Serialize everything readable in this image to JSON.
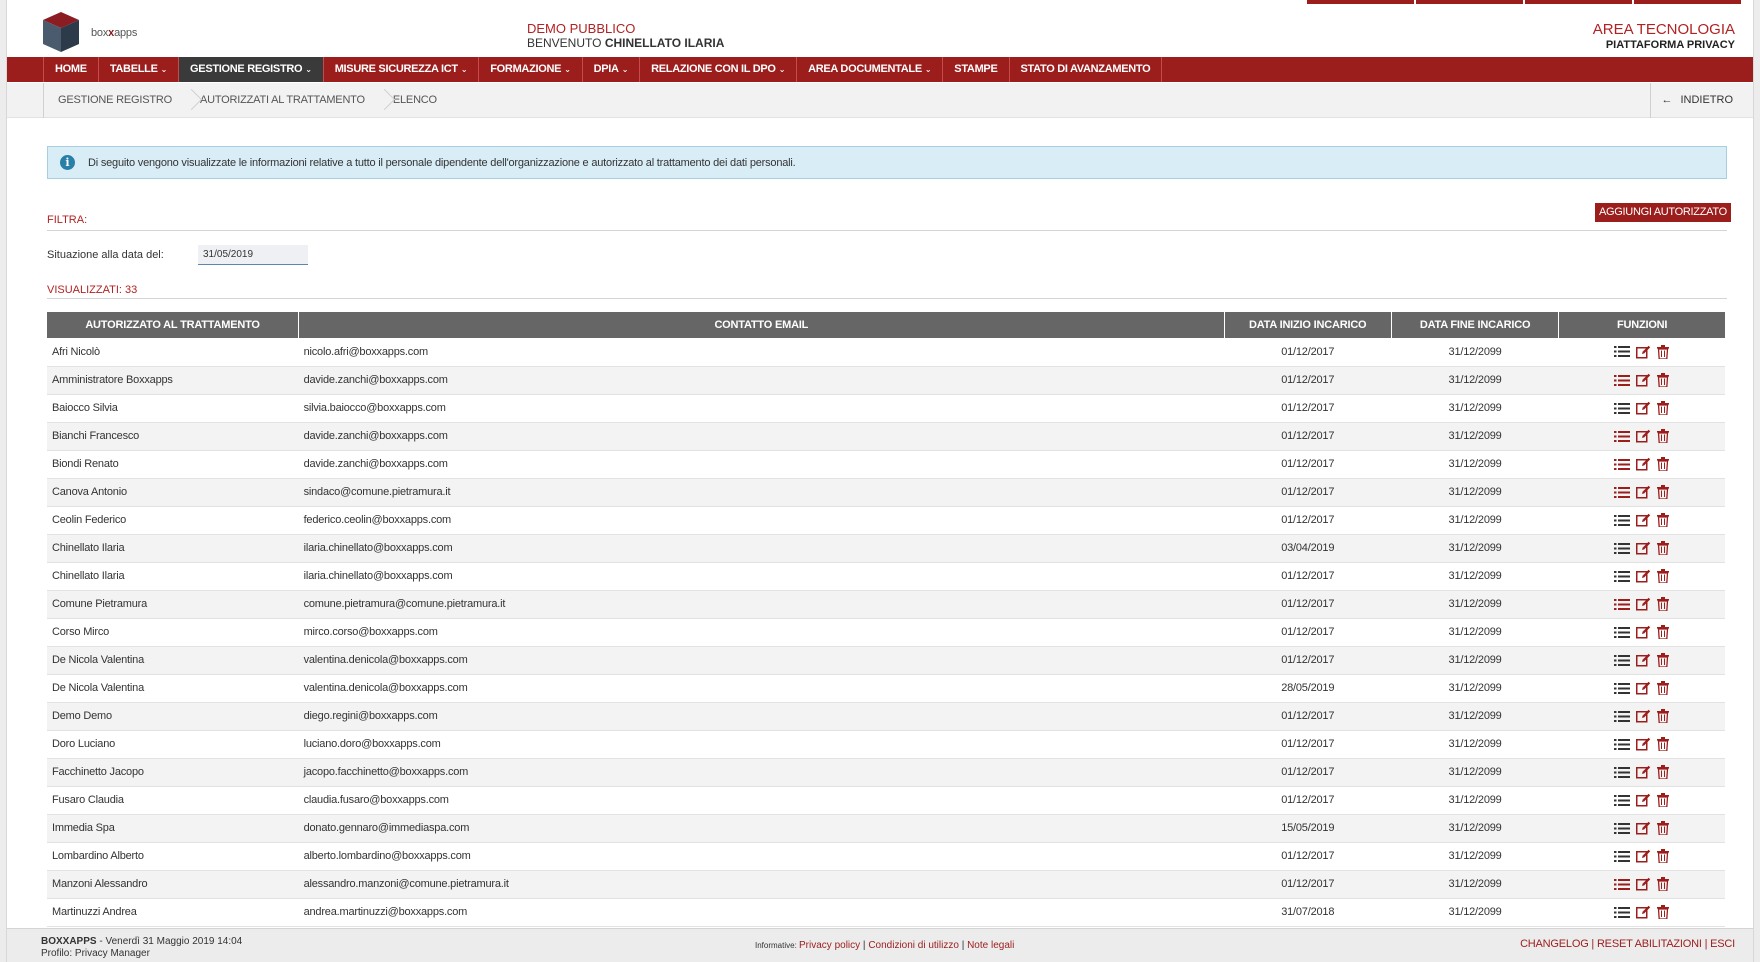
{
  "header": {
    "logo_text_a": "box",
    "logo_text_b": "x",
    "logo_text_c": "apps",
    "org": "DEMO PUBBLICO",
    "welcome_prefix": "BENVENUTO",
    "user": "CHINELLATO ILARIA",
    "area": "AREA TECNOLOGIA",
    "platform": "PIATTAFORMA PRIVACY"
  },
  "nav": {
    "items": [
      {
        "label": "HOME",
        "caret": false,
        "active": false
      },
      {
        "label": "TABELLE",
        "caret": true,
        "active": false
      },
      {
        "label": "GESTIONE REGISTRO",
        "caret": true,
        "active": true
      },
      {
        "label": "MISURE SICUREZZA ICT",
        "caret": true,
        "active": false
      },
      {
        "label": "FORMAZIONE",
        "caret": true,
        "active": false
      },
      {
        "label": "DPIA",
        "caret": true,
        "active": false
      },
      {
        "label": "RELAZIONE CON IL DPO",
        "caret": true,
        "active": false
      },
      {
        "label": "AREA DOCUMENTALE",
        "caret": true,
        "active": false
      },
      {
        "label": "STAMPE",
        "caret": false,
        "active": false
      },
      {
        "label": "STATO DI AVANZAMENTO",
        "caret": false,
        "active": false
      }
    ]
  },
  "breadcrumb": [
    "GESTIONE REGISTRO",
    "AUTORIZZATI AL TRATTAMENTO",
    "ELENCO"
  ],
  "back_label": "INDIETRO",
  "info_text": "Di seguito vengono visualizzate le informazioni relative a tutto il personale dipendente dell'organizzazione e autorizzato al trattamento dei dati personali.",
  "filter": {
    "title": "FILTRA:",
    "add_button": "AGGIUNGI AUTORIZZATO",
    "date_label": "Situazione alla data del:",
    "date_value": "31/05/2019",
    "shown": "VISUALIZZATI: 33"
  },
  "table": {
    "columns": [
      "AUTORIZZATO AL TRATTAMENTO",
      "CONTATTO EMAIL",
      "DATA INIZIO INCARICO",
      "DATA FINE INCARICO",
      "FUNZIONI"
    ],
    "rows": [
      {
        "name": "Afri Nicolò",
        "email": "nicolo.afri@boxxapps.com",
        "start": "01/12/2017",
        "end": "31/12/2099"
      },
      {
        "name": "Amministratore Boxxapps",
        "email": "davide.zanchi@boxxapps.com",
        "start": "01/12/2017",
        "end": "31/12/2099"
      },
      {
        "name": "Baiocco Silvia",
        "email": "silvia.baiocco@boxxapps.com",
        "start": "01/12/2017",
        "end": "31/12/2099"
      },
      {
        "name": "Bianchi Francesco",
        "email": "davide.zanchi@boxxapps.com",
        "start": "01/12/2017",
        "end": "31/12/2099"
      },
      {
        "name": "Biondi Renato",
        "email": "davide.zanchi@boxxapps.com",
        "start": "01/12/2017",
        "end": "31/12/2099"
      },
      {
        "name": "Canova Antonio",
        "email": "sindaco@comune.pietramura.it",
        "start": "01/12/2017",
        "end": "31/12/2099"
      },
      {
        "name": "Ceolin Federico",
        "email": "federico.ceolin@boxxapps.com",
        "start": "01/12/2017",
        "end": "31/12/2099"
      },
      {
        "name": "Chinellato Ilaria",
        "email": "ilaria.chinellato@boxxapps.com",
        "start": "03/04/2019",
        "end": "31/12/2099"
      },
      {
        "name": "Chinellato Ilaria",
        "email": "ilaria.chinellato@boxxapps.com",
        "start": "01/12/2017",
        "end": "31/12/2099"
      },
      {
        "name": "Comune Pietramura",
        "email": "comune.pietramura@comune.pietramura.it",
        "start": "01/12/2017",
        "end": "31/12/2099"
      },
      {
        "name": "Corso Mirco",
        "email": "mirco.corso@boxxapps.com",
        "start": "01/12/2017",
        "end": "31/12/2099"
      },
      {
        "name": "De Nicola Valentina",
        "email": "valentina.denicola@boxxapps.com",
        "start": "01/12/2017",
        "end": "31/12/2099"
      },
      {
        "name": "De Nicola Valentina",
        "email": "valentina.denicola@boxxapps.com",
        "start": "28/05/2019",
        "end": "31/12/2099"
      },
      {
        "name": "Demo Demo",
        "email": "diego.regini@boxxapps.com",
        "start": "01/12/2017",
        "end": "31/12/2099"
      },
      {
        "name": "Doro Luciano",
        "email": "luciano.doro@boxxapps.com",
        "start": "01/12/2017",
        "end": "31/12/2099"
      },
      {
        "name": "Facchinetto Jacopo",
        "email": "jacopo.facchinetto@boxxapps.com",
        "start": "01/12/2017",
        "end": "31/12/2099"
      },
      {
        "name": "Fusaro Claudia",
        "email": "claudia.fusaro@boxxapps.com",
        "start": "01/12/2017",
        "end": "31/12/2099"
      },
      {
        "name": "Immedia Spa",
        "email": "donato.gennaro@immediaspa.com",
        "start": "15/05/2019",
        "end": "31/12/2099"
      },
      {
        "name": "Lombardino Alberto",
        "email": "alberto.lombardino@boxxapps.com",
        "start": "01/12/2017",
        "end": "31/12/2099"
      },
      {
        "name": "Manzoni Alessandro",
        "email": "alessandro.manzoni@comune.pietramura.it",
        "start": "01/12/2017",
        "end": "31/12/2099"
      },
      {
        "name": "Martinuzzi Andrea",
        "email": "andrea.martinuzzi@boxxapps.com",
        "start": "31/07/2018",
        "end": "31/12/2099"
      }
    ],
    "red_list_rows": [
      1,
      3,
      4,
      5,
      9,
      19
    ]
  },
  "footer": {
    "brand": "BOXXAPPS",
    "datetime": " - Venerdì 31 Maggio 2019 14:04",
    "profile": "Profilo: Privacy Manager",
    "info_label": "Informative: ",
    "privacy": "Privacy policy",
    "terms": "Condizioni di utilizzo",
    "legal": "Note legali",
    "sep": " | ",
    "changelog": "CHANGELOG",
    "reset": "RESET ABILITAZIONI",
    "exit": "ESCI"
  },
  "colors": {
    "brand_red": "#9b1d1c",
    "accent_red": "#b22222",
    "table_header": "#666666",
    "info_bg": "#d9edf7",
    "icon_dark": "#333333"
  }
}
